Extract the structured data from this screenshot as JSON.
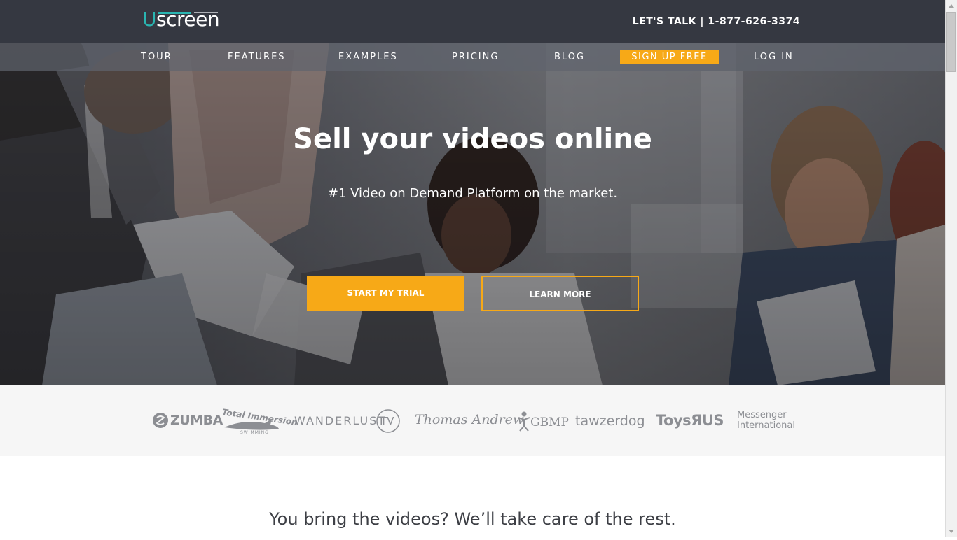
{
  "brand": {
    "logo_u": "U",
    "logo_rest": "screen",
    "accent": "#2ab5b1",
    "cta_color": "#f7a917"
  },
  "header": {
    "contact": "LET'S TALK | 1-877-626-3374"
  },
  "nav": {
    "items": [
      {
        "label": "TOUR"
      },
      {
        "label": "FEATURES"
      },
      {
        "label": "EXAMPLES"
      },
      {
        "label": "PRICING"
      },
      {
        "label": "BLOG"
      }
    ],
    "signup": "SIGN UP FREE",
    "login": "LOG IN"
  },
  "hero": {
    "title": "Sell your videos online",
    "subtitle": "#1 Video on Demand Platform on the market.",
    "primary_button": "START MY TRIAL",
    "secondary_button": "LEARN MORE"
  },
  "clients": {
    "zumba": "ZUMBA",
    "total_immersion": "Total Immersion",
    "total_immersion_sub": "SWIMMING",
    "wanderlust": "WANDERLUST",
    "wanderlust_tv": "TV",
    "thomas_andrew": "Thomas Andrew",
    "gbmp": "GBMP",
    "tawzerdog": "tawzerdog",
    "toysrus": "ToysЯUS",
    "messenger_line1": "Messenger",
    "messenger_line2": "International"
  },
  "section": {
    "tagline": "You bring the videos? We’ll take care of the rest."
  }
}
